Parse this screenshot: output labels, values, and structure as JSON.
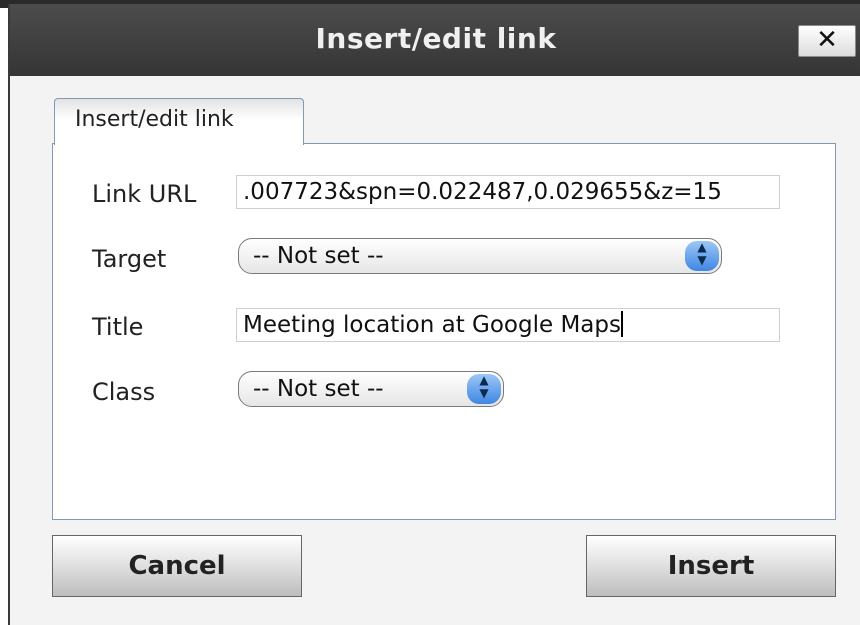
{
  "dialog": {
    "title": "Insert/edit link",
    "close_label": "✕"
  },
  "tabs": [
    {
      "label": "Insert/edit link",
      "active": true
    }
  ],
  "form": {
    "link_url": {
      "label": "Link URL",
      "value": ".007723&spn=0.022487,0.029655&z=15"
    },
    "target": {
      "label": "Target",
      "selected": "-- Not set --"
    },
    "title": {
      "label": "Title",
      "value": "Meeting location at Google Maps"
    },
    "class": {
      "label": "Class",
      "selected": "-- Not set --"
    }
  },
  "buttons": {
    "cancel": "Cancel",
    "insert": "Insert"
  },
  "icons": {
    "stepper": "up-down-stepper-icon"
  },
  "colors": {
    "titlebar": "#3f3f3f",
    "panel_border": "#7f9ab5",
    "stepper_blue": "#3f86e3"
  }
}
